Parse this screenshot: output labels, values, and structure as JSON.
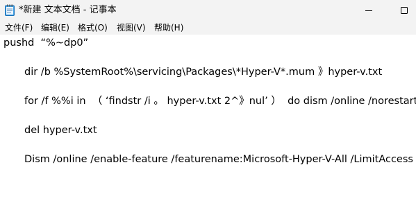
{
  "window": {
    "title": "*新建 文本文档 - 记事本",
    "app_icon": "notepad-icon",
    "minimize_icon": "minimize-icon",
    "maximize_icon": "maximize-icon"
  },
  "menu": {
    "file": "文件(F)",
    "edit": "编辑(E)",
    "format": "格式(O)",
    "view": "视图(V)",
    "help": "帮助(H)"
  },
  "editor": {
    "lines": [
      "pushd  “%~dp0”",
      "dir /b %SystemRoot%\\servicing\\Packages\\*Hyper-V*.mum 》hyper-v.txt",
      "for /f %%i in  （ ‘findstr /i 。 hyper-v.txt 2^》nul’ ）  do dism /online /norestart /add-package:“%SystemRoot%\\servicing\\Packages\\%%i”",
      "del hyper-v.txt",
      "Dism /online /enable-feature /featurename:Microsoft-Hyper-V-All /LimitAccess /ALL"
    ]
  }
}
